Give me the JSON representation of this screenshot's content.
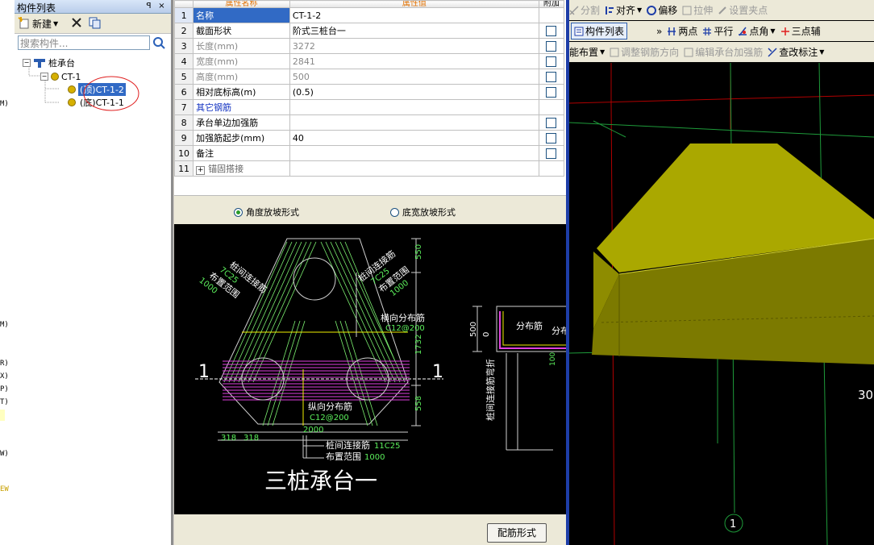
{
  "left_strip": {
    "letters": [
      "M)",
      "M)",
      "R)",
      "X)",
      "P)",
      "T)",
      "W)",
      "EW"
    ]
  },
  "component_panel": {
    "title": "构件列表",
    "pin_label": "ꟼ",
    "close_label": "×",
    "new_button": "新建",
    "search_placeholder": "搜索构件...",
    "tree": {
      "root": "桩承台",
      "group": "CT-1",
      "items": [
        "(顶)CT-1-2",
        "(底)CT-1-1"
      ]
    }
  },
  "property_table": {
    "headers": {
      "name": "属性名称",
      "value": "属性值",
      "extra": "附加"
    },
    "rows": [
      {
        "num": "1",
        "name": "名称",
        "value": "CT-1-2",
        "checkbox": false
      },
      {
        "num": "2",
        "name": "截面形状",
        "value": "阶式三桩台一",
        "checkbox": true
      },
      {
        "num": "3",
        "name": "长度(mm)",
        "value": "3272",
        "checkbox": true
      },
      {
        "num": "4",
        "name": "宽度(mm)",
        "value": "2841",
        "checkbox": true
      },
      {
        "num": "5",
        "name": "高度(mm)",
        "value": "500",
        "checkbox": true
      },
      {
        "num": "6",
        "name": "相对底标高(m)",
        "value": "(0.5)",
        "checkbox": true
      },
      {
        "num": "7",
        "name": "其它钢筋",
        "value": "",
        "checkbox": false
      },
      {
        "num": "8",
        "name": "承台单边加强筋",
        "value": "",
        "checkbox": true
      },
      {
        "num": "9",
        "name": "加强筋起步(mm)",
        "value": "40",
        "checkbox": true
      },
      {
        "num": "10",
        "name": "备注",
        "value": "",
        "checkbox": true
      },
      {
        "num": "11",
        "name": "锚固搭接",
        "value": "",
        "checkbox": false
      }
    ],
    "expand_label": "+"
  },
  "slope_options": {
    "angle": "角度放坡形式",
    "bottom_width": "底宽放坡形式",
    "selected": "angle"
  },
  "drawing": {
    "title": "三桩承台一",
    "section_mark": "1",
    "labels": {
      "left_rebar": "桩间连接筋",
      "left_rebar_spec": "7C25",
      "left_range": "布置范围",
      "left_range_val": "1000",
      "right_rebar": "桩间连接筋",
      "right_rebar_spec": "7C25",
      "right_range": "布置范围",
      "right_range_val": "1000",
      "horizontal_dist": "横向分布筋",
      "horizontal_spec": "C12@200",
      "vertical_dist": "纵向分布筋",
      "vertical_spec": "C12@200",
      "bottom_rebar": "桩间连接筋",
      "bottom_rebar_spec": "11C25",
      "bottom_range": "布置范围",
      "bottom_range_val": "1000",
      "dim_550_top": "550",
      "dim_1732": "1732",
      "dim_558": "558",
      "dim_2000": "2000",
      "dim_318a": "318",
      "dim_318b": "318",
      "section_dist": "分布筋",
      "section_dist2": "分布",
      "section_500": "500",
      "section_0": "0",
      "section_100": "100",
      "section_vertical": "桩间连接筋弯折"
    }
  },
  "rebar_form_button": "配筋形式",
  "view3d": {
    "toolbar1": [
      "分割",
      "对齐",
      "偏移",
      "拉伸",
      "设置夹点"
    ],
    "toolbar2": {
      "component_list": "构件列表",
      "more": "»",
      "items": [
        "两点",
        "平行",
        "点角",
        "三点辅"
      ]
    },
    "toolbar3": [
      "能布置",
      "调整钢筋方向",
      "编辑承台加强筋",
      "查改标注"
    ],
    "axis_label": "1",
    "dim_text": "30",
    "colors": {
      "body": "#7c7a00",
      "top": "#aaa800",
      "grid_green": "#1e9a3a",
      "grid_red": "#b00000"
    }
  }
}
